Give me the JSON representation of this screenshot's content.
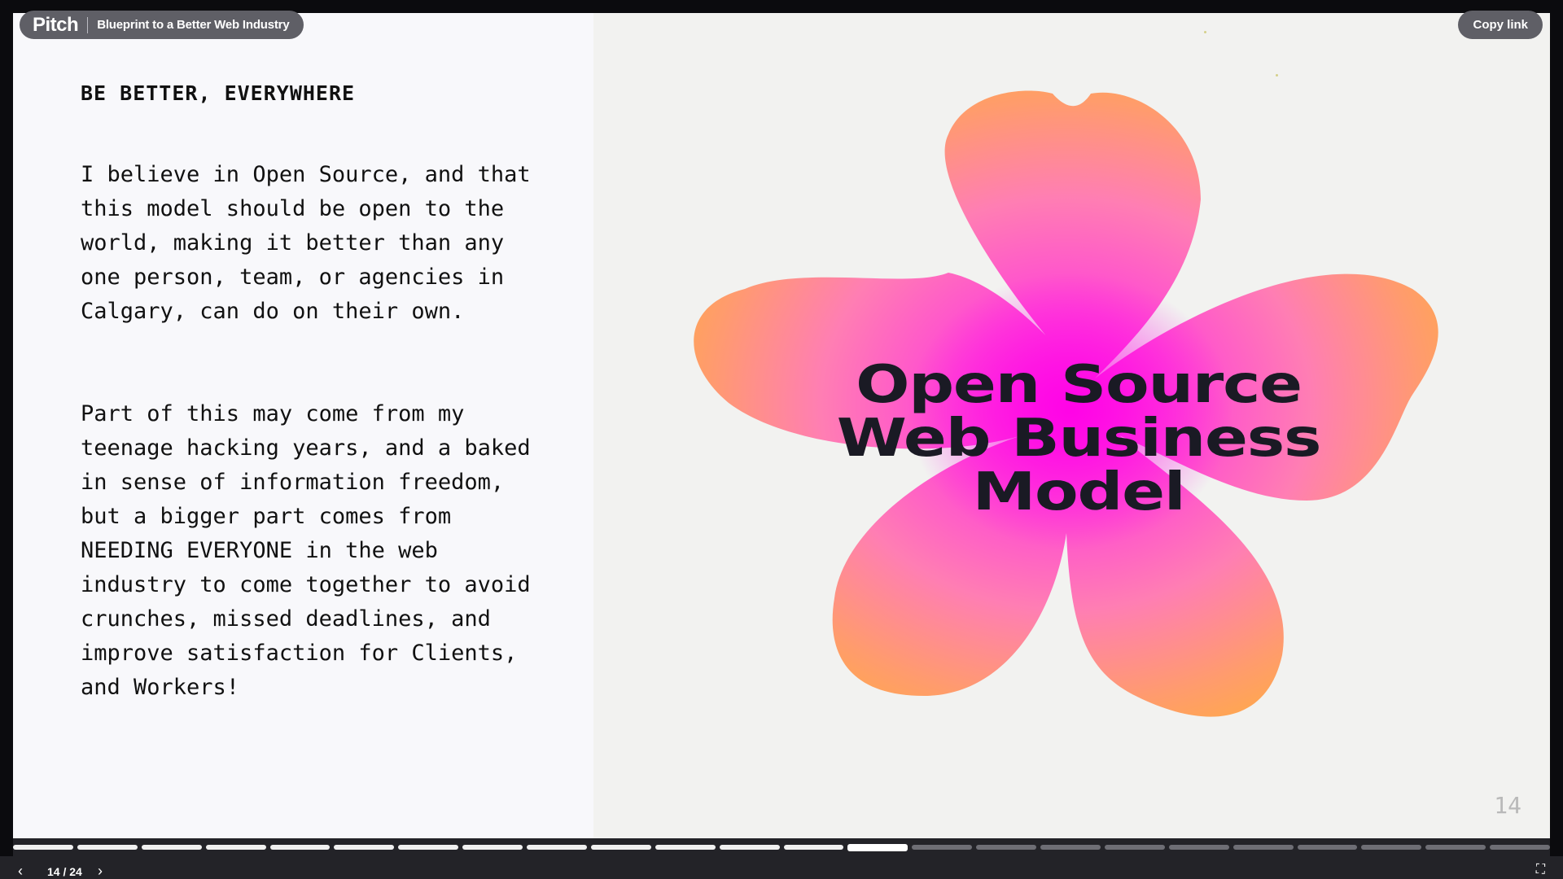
{
  "header": {
    "brand": "Pitch",
    "presentation_title": "Blueprint to a Better Web Industry",
    "copy_link_label": "Copy link"
  },
  "slide": {
    "heading": "BE BETTER, EVERYWHERE",
    "paragraphs": [
      "I believe in Open Source, and that\nthis model should be open to the\nworld, making it better than any\none person, team, or agencies in\nCalgary, can do on their own.",
      "Part of this may come from my\nteenage hacking years, and a baked\nin sense of information freedom,\nbut a bigger part comes from\nNEEDING EVERYONE in the web\nindustry to come together to avoid\ncrunches, missed deadlines, and\nimprove satisfaction for Clients,\nand Workers!"
    ],
    "hero_title_lines": [
      "Open Source",
      "Web Business",
      "Model"
    ],
    "slide_number": "14",
    "image_icon": "hibiscus-flower-image"
  },
  "navigation": {
    "counter": "14 / 24",
    "current": 14,
    "total": 24,
    "prev_icon": "chevron-left-icon",
    "next_icon": "chevron-right-icon",
    "fullscreen_icon": "fullscreen-icon"
  },
  "colors": {
    "flower_edge": "#ffa64a",
    "flower_center": "#ff2fe0",
    "title_color": "#1a1a24"
  }
}
